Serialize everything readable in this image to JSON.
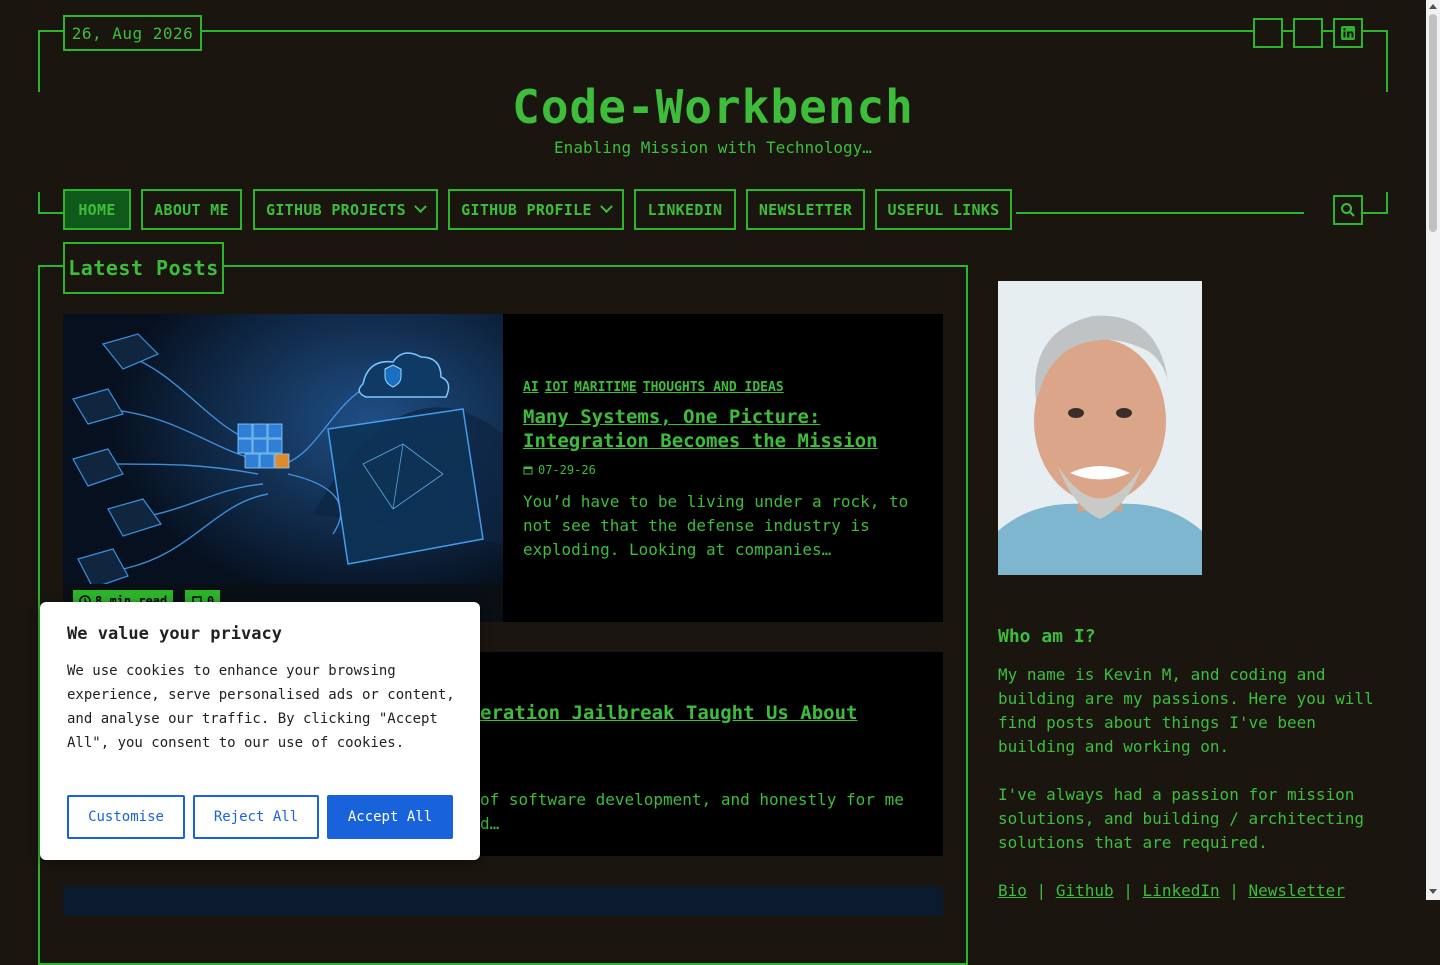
{
  "header": {
    "date": "26, Aug 2026",
    "site_title": "Code-Workbench",
    "tagline": "Enabling Mission with Technology…",
    "social_icons": [
      "blank-icon",
      "blank-icon",
      "linkedin-icon"
    ]
  },
  "nav": {
    "items": [
      {
        "label": "HOME",
        "active": true,
        "dropdown": false
      },
      {
        "label": "ABOUT ME",
        "dropdown": false
      },
      {
        "label": "GITHUB PROJECTS",
        "dropdown": true
      },
      {
        "label": "GITHUB PROFILE",
        "dropdown": true
      },
      {
        "label": "LINKEDIN",
        "dropdown": false
      },
      {
        "label": "NEWSLETTER",
        "dropdown": false
      },
      {
        "label": "USEFUL LINKS",
        "dropdown": false
      }
    ]
  },
  "main": {
    "section_title": "Latest Posts",
    "posts": [
      {
        "categories": [
          "AI",
          "IOT",
          "MARITIME",
          "THOUGHTS AND IDEAS"
        ],
        "title": "Many Systems, One Picture: Integration Becomes the Mission",
        "date": "07-29-26",
        "excerpt": "You’d have to be living under a rock, to not see that the defense industry is exploding. Looking at companies…",
        "read_time": "8 min read",
        "comments": "0"
      },
      {
        "title_visible": "eration Jailbreak Taught Us About",
        "excerpt_visible_1": "of software development, and honestly for me",
        "excerpt_visible_2": "d…"
      }
    ]
  },
  "sidebar": {
    "who_title": "Who am I?",
    "para1": "My name is Kevin M, and coding and building are my passions. Here you will find posts about things I've been building and working on.",
    "para2": "I've always had a passion for mission solutions, and building / architecting solutions that are required.",
    "links": [
      "Bio",
      "Github",
      "LinkedIn",
      "Newsletter"
    ],
    "separator": "|"
  },
  "cookie": {
    "title": "We value your privacy",
    "body": "We use cookies to enhance your browsing experience, serve personalised ads or content, and analyse our traffic. By clicking \"Accept All\", you consent to our use of cookies.",
    "customise": "Customise",
    "reject": "Reject All",
    "accept": "Accept All"
  },
  "colors": {
    "background": "#1b1510",
    "accent_green": "#2db42b",
    "cookie_blue": "#1863dc"
  }
}
